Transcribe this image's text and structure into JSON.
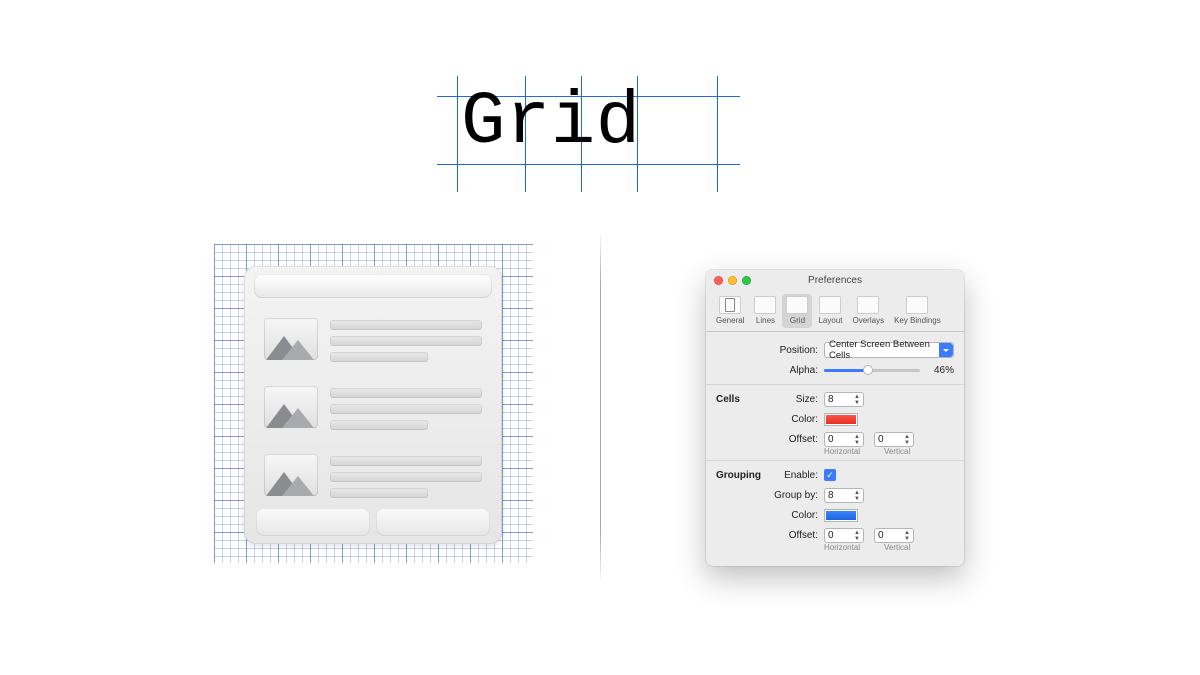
{
  "title": "Grid",
  "prefs": {
    "window_title": "Preferences",
    "tabs": {
      "general": "General",
      "lines": "Lines",
      "grid": "Grid",
      "layout": "Layout",
      "overlays": "Overlays",
      "keys": "Key Bindings"
    },
    "position_label": "Position:",
    "position_value": "Center Screen Between Cells",
    "alpha_label": "Alpha:",
    "alpha_value": "46%",
    "cells": {
      "section": "Cells",
      "size_label": "Size:",
      "size_value": "8",
      "color_label": "Color:",
      "offset_label": "Offset:",
      "offset_h": "0",
      "offset_v": "0",
      "horiz": "Horizontal",
      "vert": "Vertical"
    },
    "grouping": {
      "section": "Grouping",
      "enable_label": "Enable:",
      "groupby_label": "Group by:",
      "groupby_value": "8",
      "color_label": "Color:",
      "offset_label": "Offset:",
      "offset_h": "0",
      "offset_v": "0",
      "horiz": "Horizontal",
      "vert": "Vertical"
    }
  }
}
